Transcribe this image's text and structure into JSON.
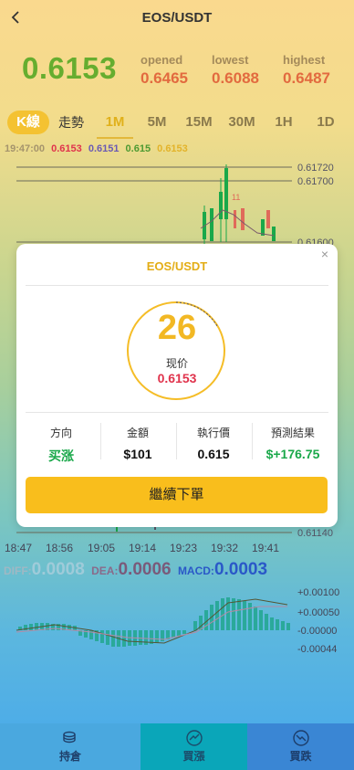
{
  "header": {
    "title": "EOS/USDT"
  },
  "ticker": {
    "price": "0.6153",
    "opened_label": "opened",
    "opened_value": "0.6465",
    "lowest_label": "lowest",
    "lowest_value": "0.6088",
    "highest_label": "highest",
    "highest_value": "0.6487"
  },
  "tabs": {
    "kline": "K線",
    "trend": "走勢",
    "periods": [
      "1M",
      "5M",
      "15M",
      "30M",
      "1H",
      "1D"
    ],
    "active": "1M"
  },
  "ohlc": {
    "time": "19:47:00",
    "open": "0.6153",
    "high": "0.6151",
    "low": "0.615",
    "close": "0.6153"
  },
  "price_axis": [
    "0.61720",
    "0.61700",
    "0.61600",
    "0.61140"
  ],
  "time_axis": [
    "18:47",
    "18:56",
    "19:05",
    "19:14",
    "19:23",
    "19:32",
    "19:41"
  ],
  "macd": {
    "diff_label": "DIFF:",
    "diff_value": "0.0008",
    "dea_label": "DEA:",
    "dea_value": "0.0006",
    "macd_label": "MACD:",
    "macd_value": "0.0003",
    "axis": [
      "+0.00100",
      "+0.00050",
      "-0.00000",
      "-0.00044"
    ]
  },
  "modal": {
    "title": "EOS/USDT",
    "countdown": "26",
    "current_price_label": "现价",
    "current_price": "0.6153",
    "columns": [
      {
        "label": "方向",
        "value": "买涨"
      },
      {
        "label": "金額",
        "value": "$101"
      },
      {
        "label": "執行價",
        "value": "0.615"
      },
      {
        "label": "預測結果",
        "value": "$+176.75"
      }
    ],
    "continue_label": "繼續下單",
    "close_glyph": "×"
  },
  "bottom_nav": [
    {
      "label": "持倉",
      "icon": "coins-icon"
    },
    {
      "label": "買漲",
      "icon": "buy-up-icon"
    },
    {
      "label": "買跌",
      "icon": "buy-down-icon"
    }
  ],
  "colors": {
    "price_up": "#66ad2f",
    "stat_value": "#e26a3f",
    "accent": "#f9be1c",
    "up_green": "#1aa84a",
    "down_red": "#e0334c",
    "nav_mid": "#0aa6b9",
    "nav_right": "#3a86d4"
  }
}
